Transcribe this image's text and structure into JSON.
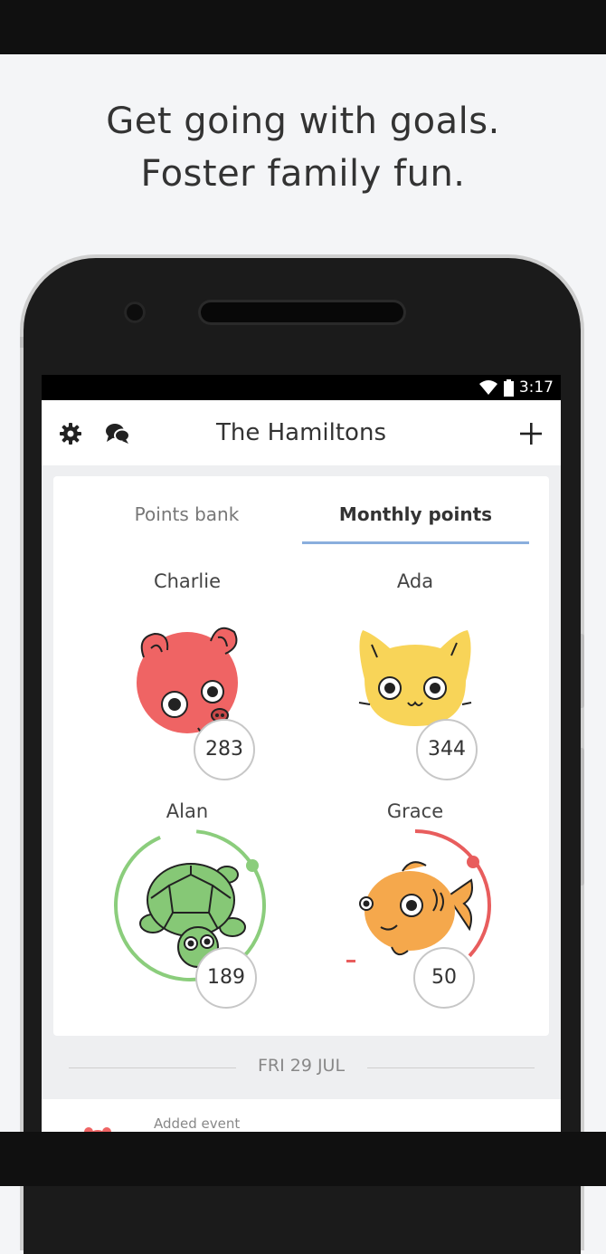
{
  "headline": {
    "line1": "Get going with goals.",
    "line2": "Foster family fun."
  },
  "status_bar": {
    "time": "3:17"
  },
  "app_bar": {
    "title": "The Hamiltons",
    "settings_icon": "gear-icon",
    "chat_icon": "chat-bubbles-icon",
    "add_icon": "plus-icon"
  },
  "tabs": [
    {
      "label": "Points bank",
      "active": false
    },
    {
      "label": "Monthly points",
      "active": true
    }
  ],
  "members": [
    {
      "name": "Charlie",
      "points": "283",
      "avatar": "pig-icon",
      "color": "#ef6464"
    },
    {
      "name": "Ada",
      "points": "344",
      "avatar": "cat-icon",
      "color": "#f8d458"
    },
    {
      "name": "Alan",
      "points": "189",
      "avatar": "turtle-icon",
      "color": "#86c876",
      "ring_color": "#8bcd7c",
      "ring_progress": 0.92
    },
    {
      "name": "Grace",
      "points": "50",
      "avatar": "fish-icon",
      "color": "#f5a84c",
      "ring_color": "#e85d5d",
      "ring_progress": 0.45
    }
  ],
  "feed": {
    "date": "FRI 29 JUL",
    "first_item": "Added event"
  }
}
